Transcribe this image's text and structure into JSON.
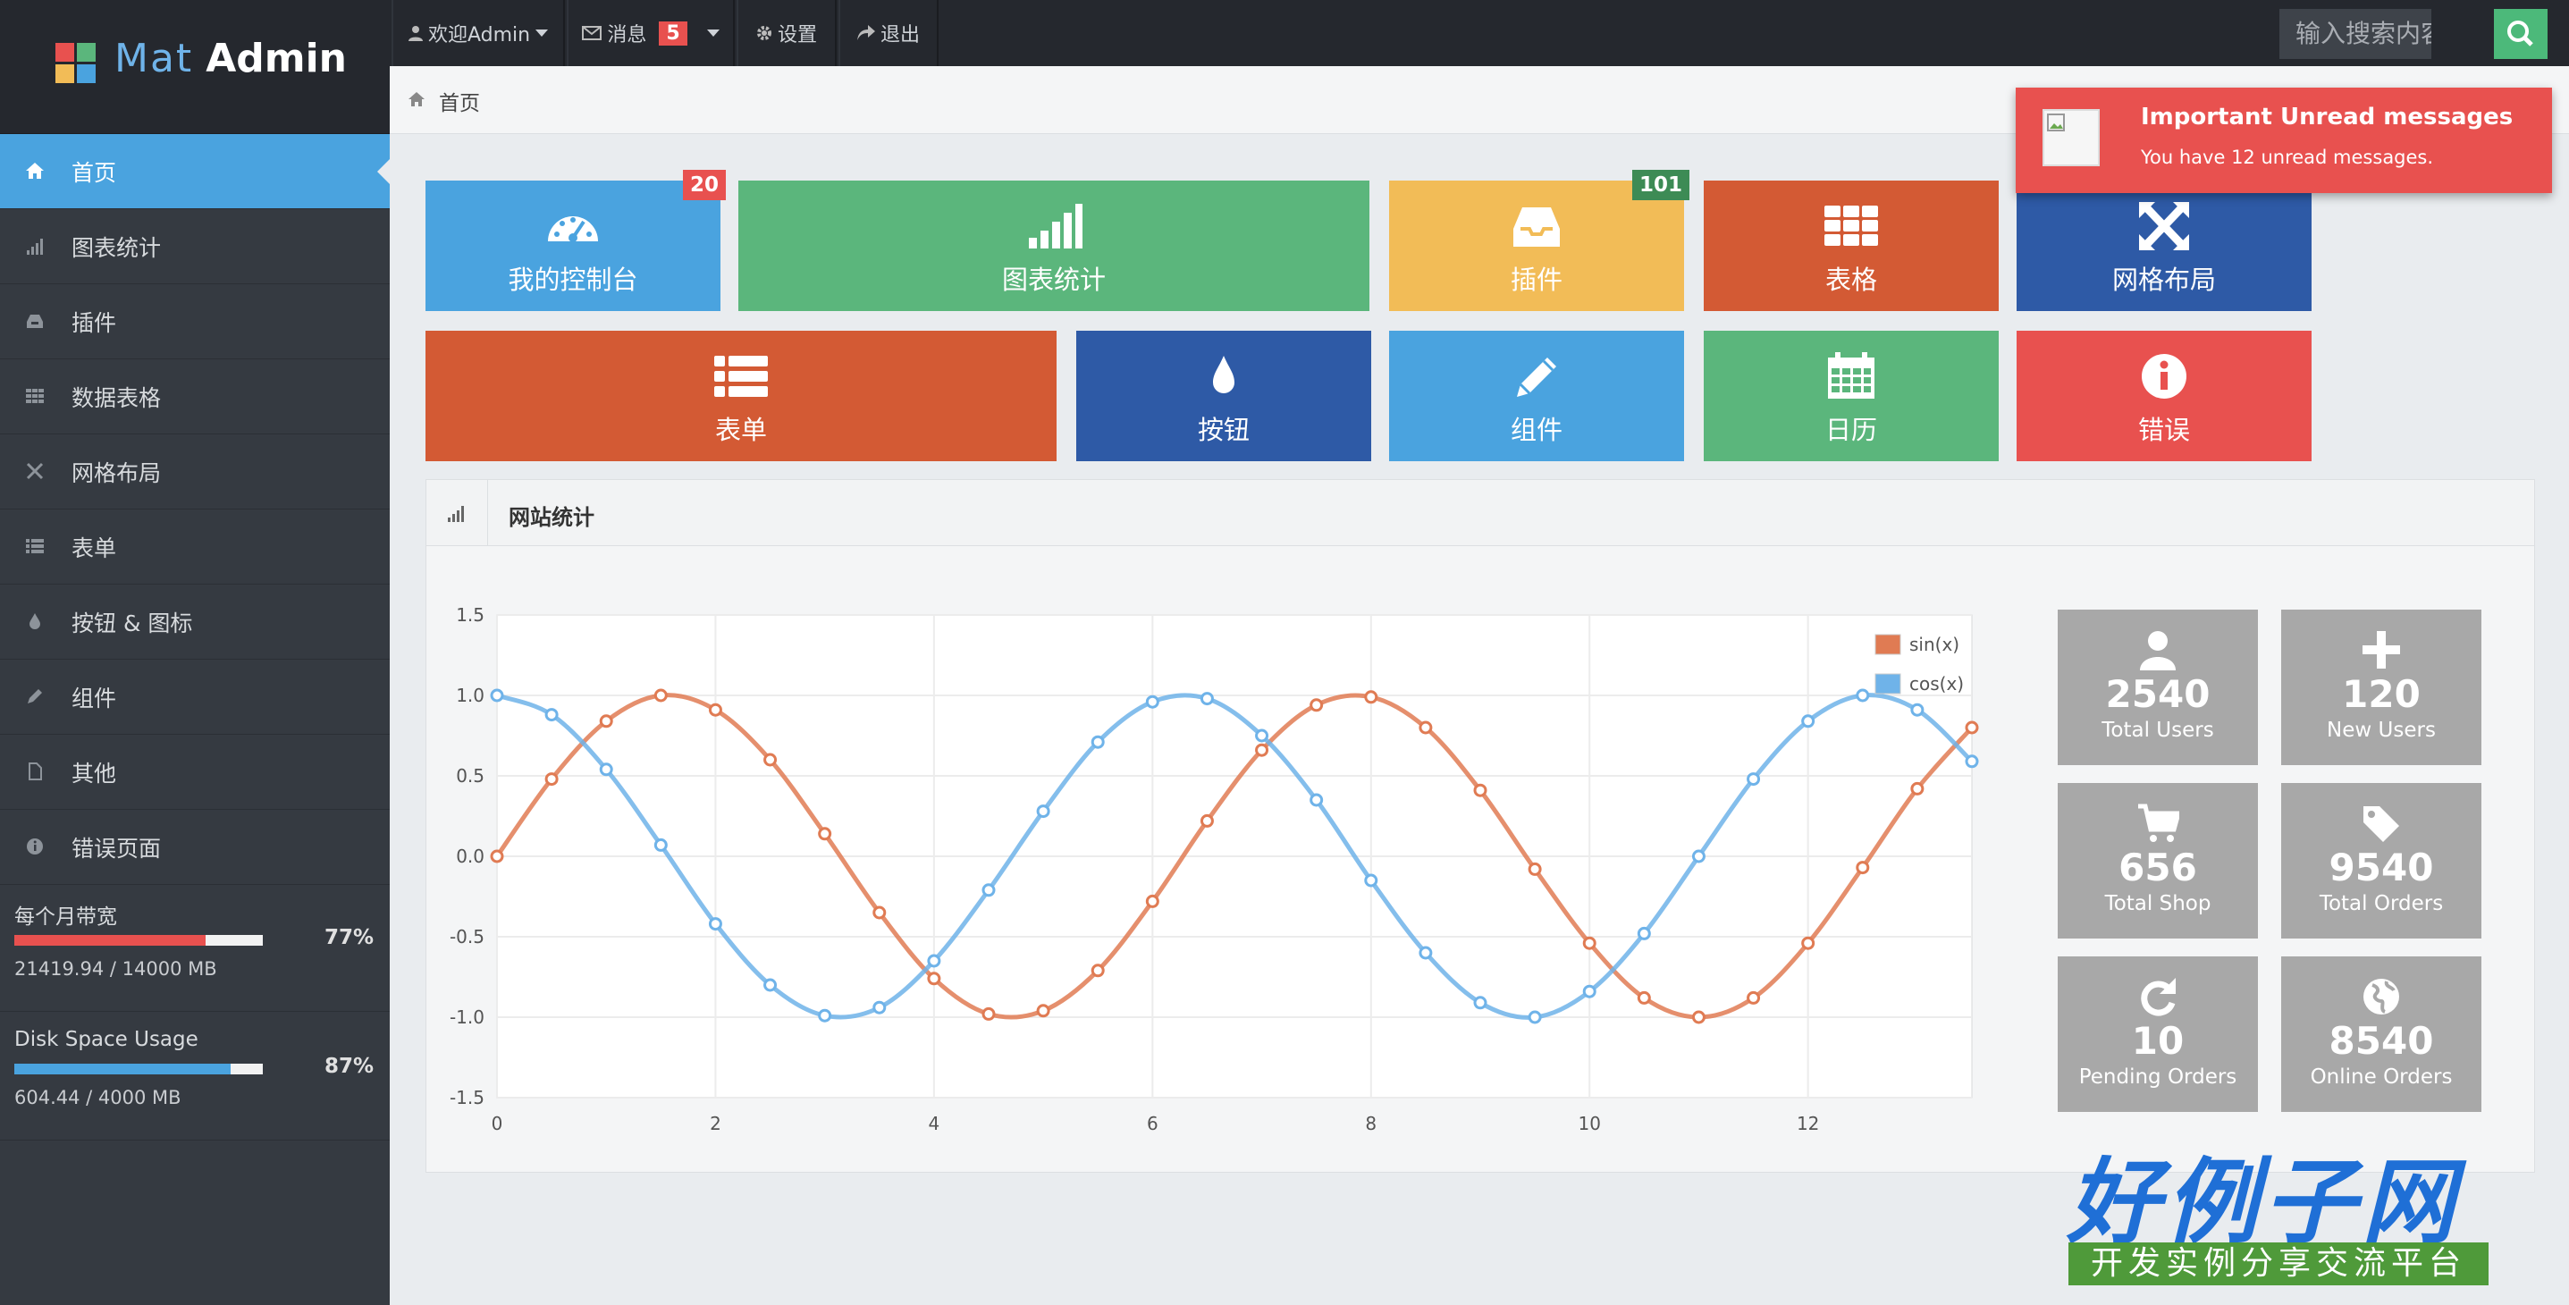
{
  "brand": {
    "mat": "Mat",
    "admin": "Admin"
  },
  "topnav": {
    "welcome": "欢迎Admin",
    "messages": "消息",
    "messages_count": "5",
    "settings": "设置",
    "logout": "退出"
  },
  "search": {
    "placeholder": "输入搜索内容..."
  },
  "sidebar": {
    "items": [
      {
        "label": "首页",
        "icon": "home-icon"
      },
      {
        "label": "图表统计",
        "icon": "signal-icon"
      },
      {
        "label": "插件",
        "icon": "inbox-icon"
      },
      {
        "label": "数据表格",
        "icon": "grid-icon"
      },
      {
        "label": "网格布局",
        "icon": "fullscreen-icon"
      },
      {
        "label": "表单",
        "icon": "list-icon"
      },
      {
        "label": "按钮 & 图标",
        "icon": "tint-icon"
      },
      {
        "label": "组件",
        "icon": "pencil-icon"
      },
      {
        "label": "其他",
        "icon": "file-icon"
      },
      {
        "label": "错误页面",
        "icon": "info-icon"
      }
    ],
    "usage": [
      {
        "title": "每个月带宽",
        "percent_text": "77%",
        "fraction": 0.77,
        "detail": "21419.94 / 14000 MB",
        "color": "#e8514f"
      },
      {
        "title": "Disk Space Usage",
        "percent_text": "87%",
        "fraction": 0.87,
        "detail": "604.44 / 4000 MB",
        "color": "#4aa3df"
      }
    ]
  },
  "breadcrumb": {
    "label": "首页"
  },
  "tiles": {
    "dashboard": {
      "label": "我的控制台",
      "badge": "20",
      "color": "#4aa3df"
    },
    "charts": {
      "label": "图表统计",
      "color": "#5bb67c"
    },
    "plugins": {
      "label": "插件",
      "badge": "101",
      "color": "#f2bc57"
    },
    "tables": {
      "label": "表格",
      "color": "#d35a34"
    },
    "grid": {
      "label": "网格布局",
      "color": "#2e5aa6"
    },
    "forms": {
      "label": "表单",
      "color": "#d35a34"
    },
    "buttons": {
      "label": "按钮",
      "color": "#2e5aa6"
    },
    "widgets": {
      "label": "组件",
      "color": "#4aa3df"
    },
    "calendar": {
      "label": "日历",
      "color": "#5bb67c"
    },
    "error": {
      "label": "错误",
      "color": "#e8514f"
    }
  },
  "panel": {
    "title": "网站统计"
  },
  "chart_data": {
    "type": "line",
    "title": "",
    "xlabel": "",
    "ylabel": "",
    "xlim": [
      0,
      13.5
    ],
    "ylim": [
      -1.5,
      1.5
    ],
    "xticks": [
      "0",
      "2",
      "4",
      "6",
      "8",
      "10",
      "12"
    ],
    "yticks": [
      "1.5",
      "1.0",
      "0.5",
      "0.0",
      "-0.5",
      "-1.0",
      "-1.5"
    ],
    "x": [
      0,
      0.5,
      1,
      1.5,
      2,
      2.5,
      3,
      3.5,
      4,
      4.5,
      5,
      5.5,
      6,
      6.5,
      7,
      7.5,
      8,
      8.5,
      9,
      9.5,
      10,
      10.5,
      11,
      11.5,
      12,
      12.5,
      13,
      13.5
    ],
    "series": [
      {
        "name": "sin(x)",
        "color": "#e07b53",
        "values": [
          0.0,
          0.48,
          0.84,
          1.0,
          0.91,
          0.6,
          0.14,
          -0.35,
          -0.76,
          -0.98,
          -0.96,
          -0.71,
          -0.28,
          0.22,
          0.66,
          0.94,
          0.99,
          0.8,
          0.41,
          -0.08,
          -0.54,
          -0.88,
          -1.0,
          -0.88,
          -0.54,
          -0.07,
          0.42,
          0.8
        ]
      },
      {
        "name": "cos(x)",
        "color": "#6fb3e9",
        "values": [
          1.0,
          0.88,
          0.54,
          0.07,
          -0.42,
          -0.8,
          -0.99,
          -0.94,
          -0.65,
          -0.21,
          0.28,
          0.71,
          0.96,
          0.98,
          0.75,
          0.35,
          -0.15,
          -0.6,
          -0.91,
          -1.0,
          -0.84,
          -0.48,
          0.0,
          0.48,
          0.84,
          1.0,
          0.91,
          0.59
        ]
      }
    ],
    "legend": "top-right",
    "grid": true
  },
  "stats": [
    {
      "value": "2540",
      "label": "Total Users",
      "icon": "user-icon"
    },
    {
      "value": "120",
      "label": "New Users",
      "icon": "plus-icon"
    },
    {
      "value": "656",
      "label": "Total Shop",
      "icon": "shopping-cart-icon"
    },
    {
      "value": "9540",
      "label": "Total Orders",
      "icon": "tag-icon"
    },
    {
      "value": "10",
      "label": "Pending Orders",
      "icon": "refresh-icon"
    },
    {
      "value": "8540",
      "label": "Online Orders",
      "icon": "globe-icon"
    }
  ],
  "notification": {
    "title": "Important Unread messages",
    "message": "You have 12 unread messages."
  },
  "watermark": {
    "title": "好例子网",
    "subtitle": "开发实例分享交流平台"
  }
}
